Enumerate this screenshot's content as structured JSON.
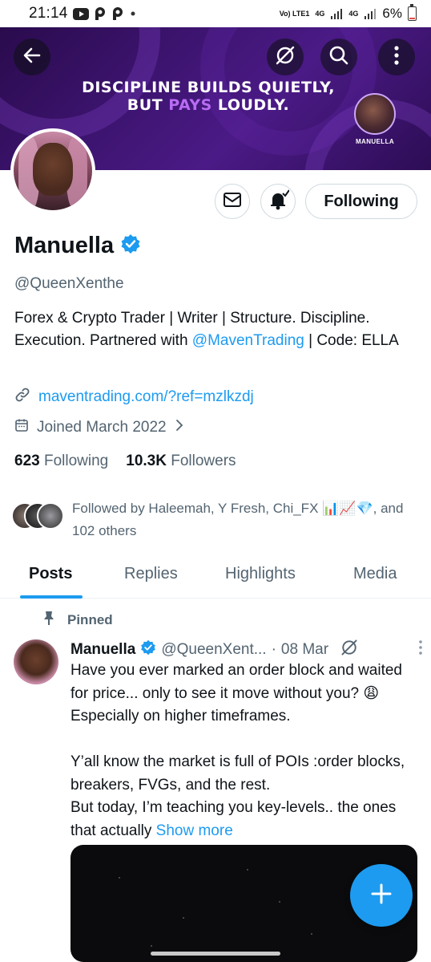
{
  "status_bar": {
    "time": "21:14",
    "network_1": "Vo) LTE1",
    "network_2": "4G",
    "network_3": "4G",
    "battery": "6%",
    "battery_level": 0.06
  },
  "banner": {
    "line1": "DISCIPLINE BUILDS QUIETLY,",
    "line2_a": "BUT ",
    "line2_highlight": "PAYS",
    "line2_b": " LOUDLY.",
    "avatar_caption": "MANUELLA"
  },
  "top_actions": {
    "back_icon": "arrow-left-icon",
    "grok_icon": "slash-circle-icon",
    "search_icon": "search-icon",
    "more_icon": "more-vertical-icon"
  },
  "profile_actions": {
    "message_icon": "mail-icon",
    "notify_icon": "bell-check-icon",
    "follow_label": "Following"
  },
  "profile": {
    "name": "Manuella",
    "handle": "@QueenXenthe",
    "bio_part1": "Forex & Crypto Trader | Writer | Structure. Discipline. Execution. Partnered with ",
    "bio_mention": "@MavenTrading",
    "bio_part2": " | Code: ELLA",
    "website": "maventrading.com/?ref=mzlkzdj",
    "joined": "Joined March 2022",
    "following_count": "623",
    "following_label": "Following",
    "followers_count": "10.3K",
    "followers_label": "Followers",
    "followed_by_text": "Followed by Haleemah, Y Fresh, Chi_FX 📊📈💎, and 102 others"
  },
  "tabs": [
    {
      "label": "Posts"
    },
    {
      "label": "Replies"
    },
    {
      "label": "Highlights"
    },
    {
      "label": "Media"
    }
  ],
  "pinned_post": {
    "pinned_label": "Pinned",
    "author_name": "Manuella",
    "author_handle": "@QueenXent...",
    "separator": "·",
    "date": "08 Mar",
    "body": "Have you ever marked an order block and waited for price... only to see it move without you? 😩 Especially on higher timeframes.\n\nY’all know the market is full of POIs :order blocks, breakers, FVGs, and the rest.\nBut today, I’m teaching you key-levels.. the ones that actually ",
    "show_more": "Show more"
  },
  "colors": {
    "accent": "#1d9bf0",
    "banner_purple": "#3d1470",
    "banner_highlight": "#b86cf2",
    "muted_text": "#536471"
  }
}
